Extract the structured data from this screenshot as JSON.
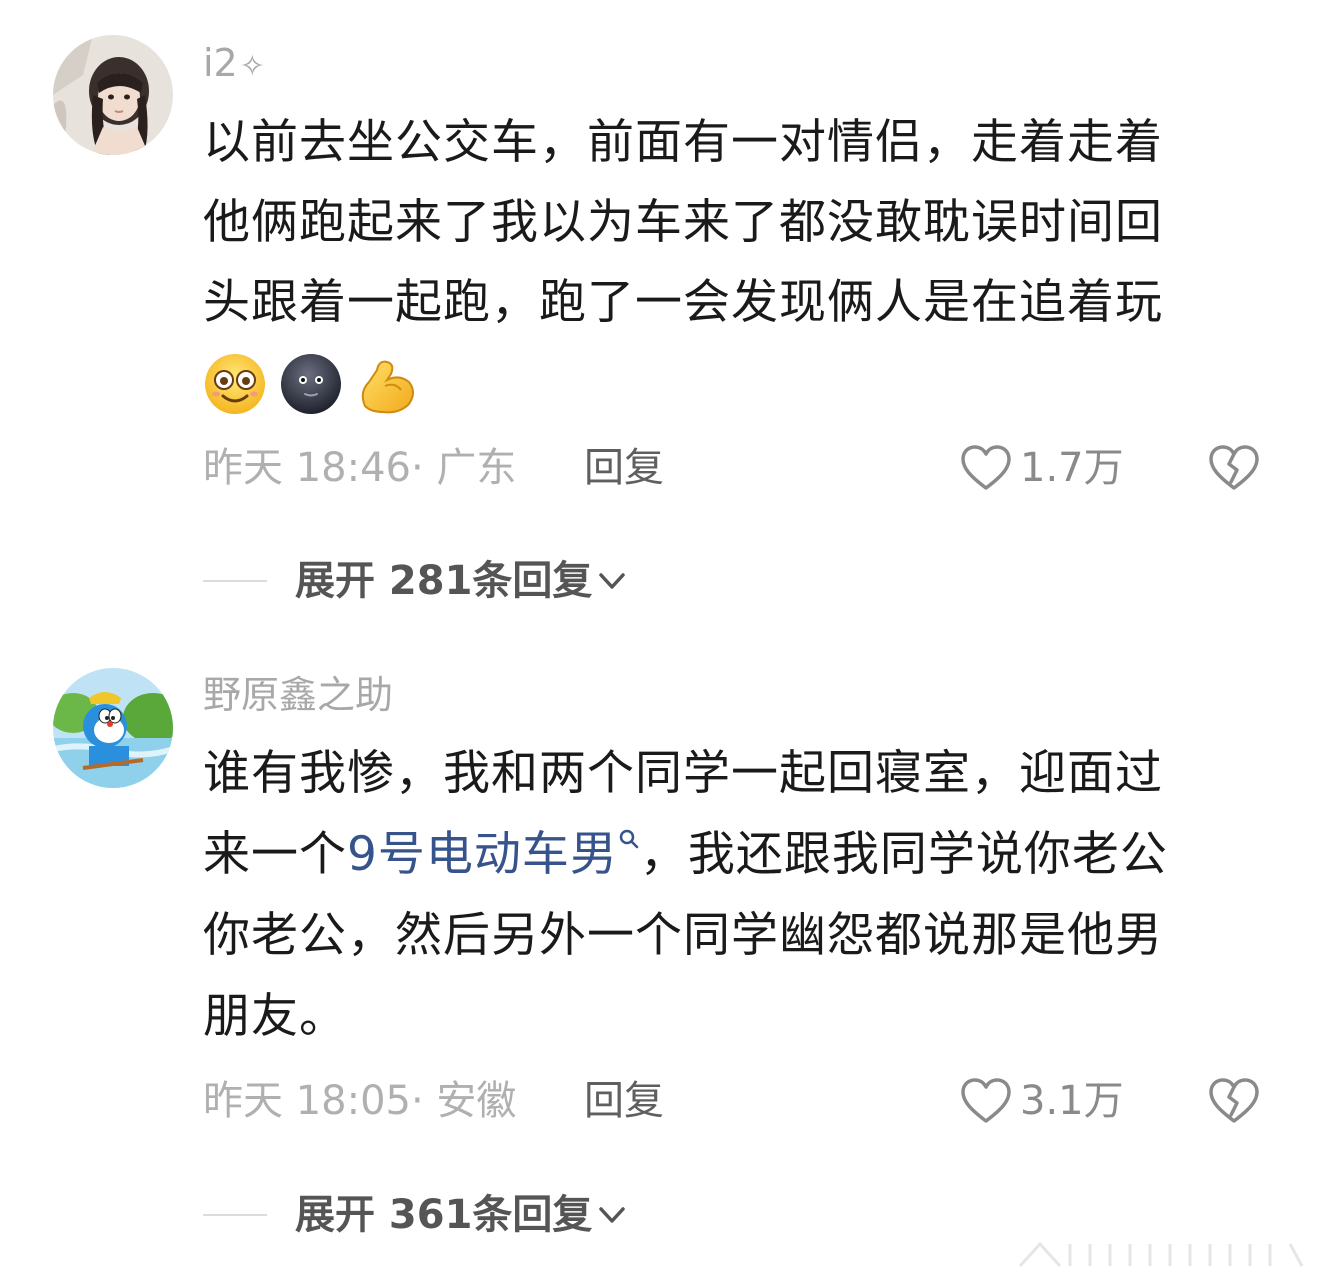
{
  "comments": [
    {
      "username": "i2",
      "username_badge": "✧",
      "lines": [
        "以前去坐公交车，前面有一对情侣，走着走着",
        "他俩跑起来了我以为车来了都没敢耽误时间回",
        "头跟着一起跑，跑了一会发现俩人是在追着玩"
      ],
      "emojis": [
        "smile-emoji",
        "dark-face-emoji",
        "muscle-emoji"
      ],
      "time_location": "昨天 18:46· 广东",
      "reply_label": "回复",
      "like_count": "1.7万",
      "expand_label": "展开 281条回复"
    },
    {
      "username": "野原鑫之助",
      "line1": "谁有我惨，我和两个同学一起回寝室，迎面过",
      "line2_before": "来一个",
      "line2_link": "9号电动车男",
      "line2_after": "，我还跟我同学说你老公",
      "line3": "你老公，然后另外一个同学幽怨都说那是他男",
      "line4": "朋友。",
      "time_location": "昨天 18:05· 安徽",
      "reply_label": "回复",
      "like_count": "3.1万",
      "expand_label": "展开 361条回复"
    }
  ],
  "colors": {
    "link": "#36538c",
    "meta": "#b0b0b0",
    "body_text": "#1a1a1a"
  }
}
